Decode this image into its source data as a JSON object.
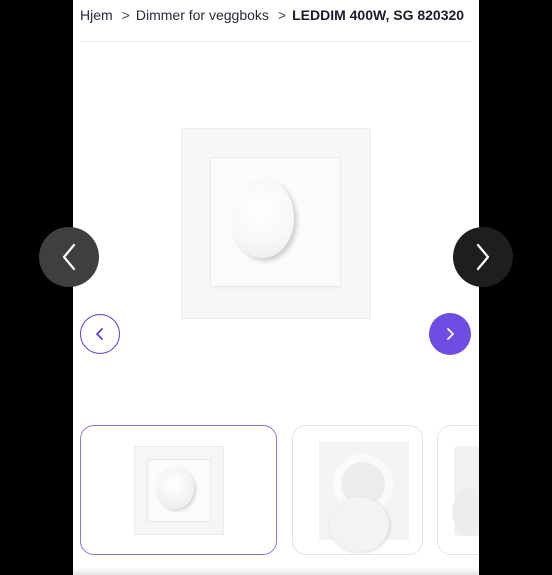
{
  "breadcrumb": {
    "items": [
      "Hjem",
      "Dimmer for veggboks"
    ],
    "separator": ">",
    "current": "LEDDIM 400W, SG 820320"
  },
  "gallery": {
    "prev_icon": "chevron-left-icon",
    "next_icon": "chevron-right-icon",
    "accent_color": "#6e4de2",
    "thumbnails": [
      {
        "name": "thumbnail-dimmer-front",
        "selected": true
      },
      {
        "name": "thumbnail-dimmer-parts",
        "selected": false
      },
      {
        "name": "thumbnail-dimmer-side",
        "selected": false
      }
    ]
  },
  "viewer_overlay": {
    "prev_icon": "chevron-left-icon",
    "next_icon": "chevron-right-icon"
  }
}
